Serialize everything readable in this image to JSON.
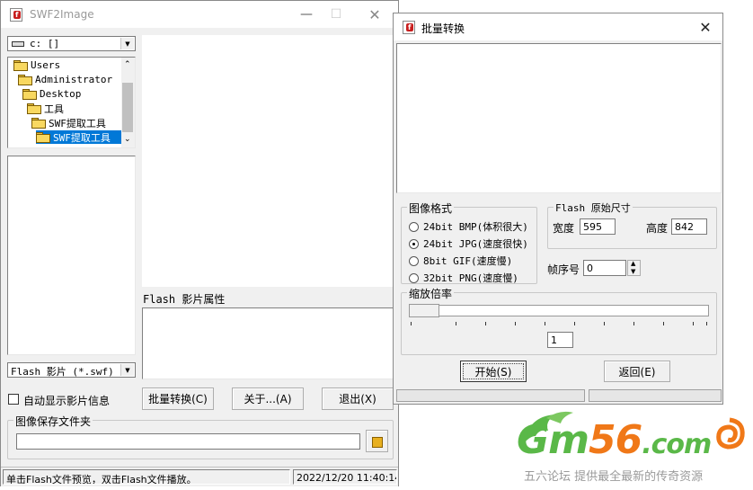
{
  "main_window": {
    "title": "SWF2Image",
    "drive_select": "c: []",
    "tree": [
      {
        "label": "Users",
        "indent": 0
      },
      {
        "label": "Administrator",
        "indent": 1
      },
      {
        "label": "Desktop",
        "indent": 2
      },
      {
        "label": "工具",
        "indent": 3
      },
      {
        "label": "SWF提取工具",
        "indent": 4
      },
      {
        "label": "SWF提取工具",
        "indent": 5,
        "selected": true
      }
    ],
    "filter_select": "Flash 影片 (*.swf)",
    "properties_label": "Flash 影片属性",
    "auto_show_label": "自动显示影片信息",
    "buttons": {
      "batch": "批量转换(C)",
      "about": "关于...(A)",
      "exit": "退出(X)"
    },
    "save_folder_label": "图像保存文件夹",
    "save_folder_value": "",
    "status_left": "单击Flash文件预览，双击Flash文件播放。",
    "status_right": "2022/12/20 11:40:14"
  },
  "batch_dialog": {
    "title": "批量转换",
    "format_group": "图像格式",
    "formats": [
      {
        "label": "24bit BMP(体积很大)",
        "selected": false
      },
      {
        "label": "24bit JPG(速度很快)",
        "selected": true
      },
      {
        "label": "8bit GIF(速度慢)",
        "selected": false
      },
      {
        "label": "32bit PNG(速度慢)",
        "selected": false
      }
    ],
    "size_group": "Flash 原始尺寸",
    "width_label": "宽度",
    "width_value": "595",
    "height_label": "高度",
    "height_value": "842",
    "frame_label": "帧序号",
    "frame_value": "0",
    "zoom_group": "缩放倍率",
    "zoom_value": "1",
    "zoom_slider_level": 0.0,
    "start_button": "开始(S)",
    "back_button": "返回(E)"
  },
  "watermark": {
    "logo_text": "Gm56.com",
    "tagline": "五六论坛 提供最全最新的传奇资源",
    "colors": {
      "green": "#5ab848",
      "orange": "#f07818"
    }
  }
}
